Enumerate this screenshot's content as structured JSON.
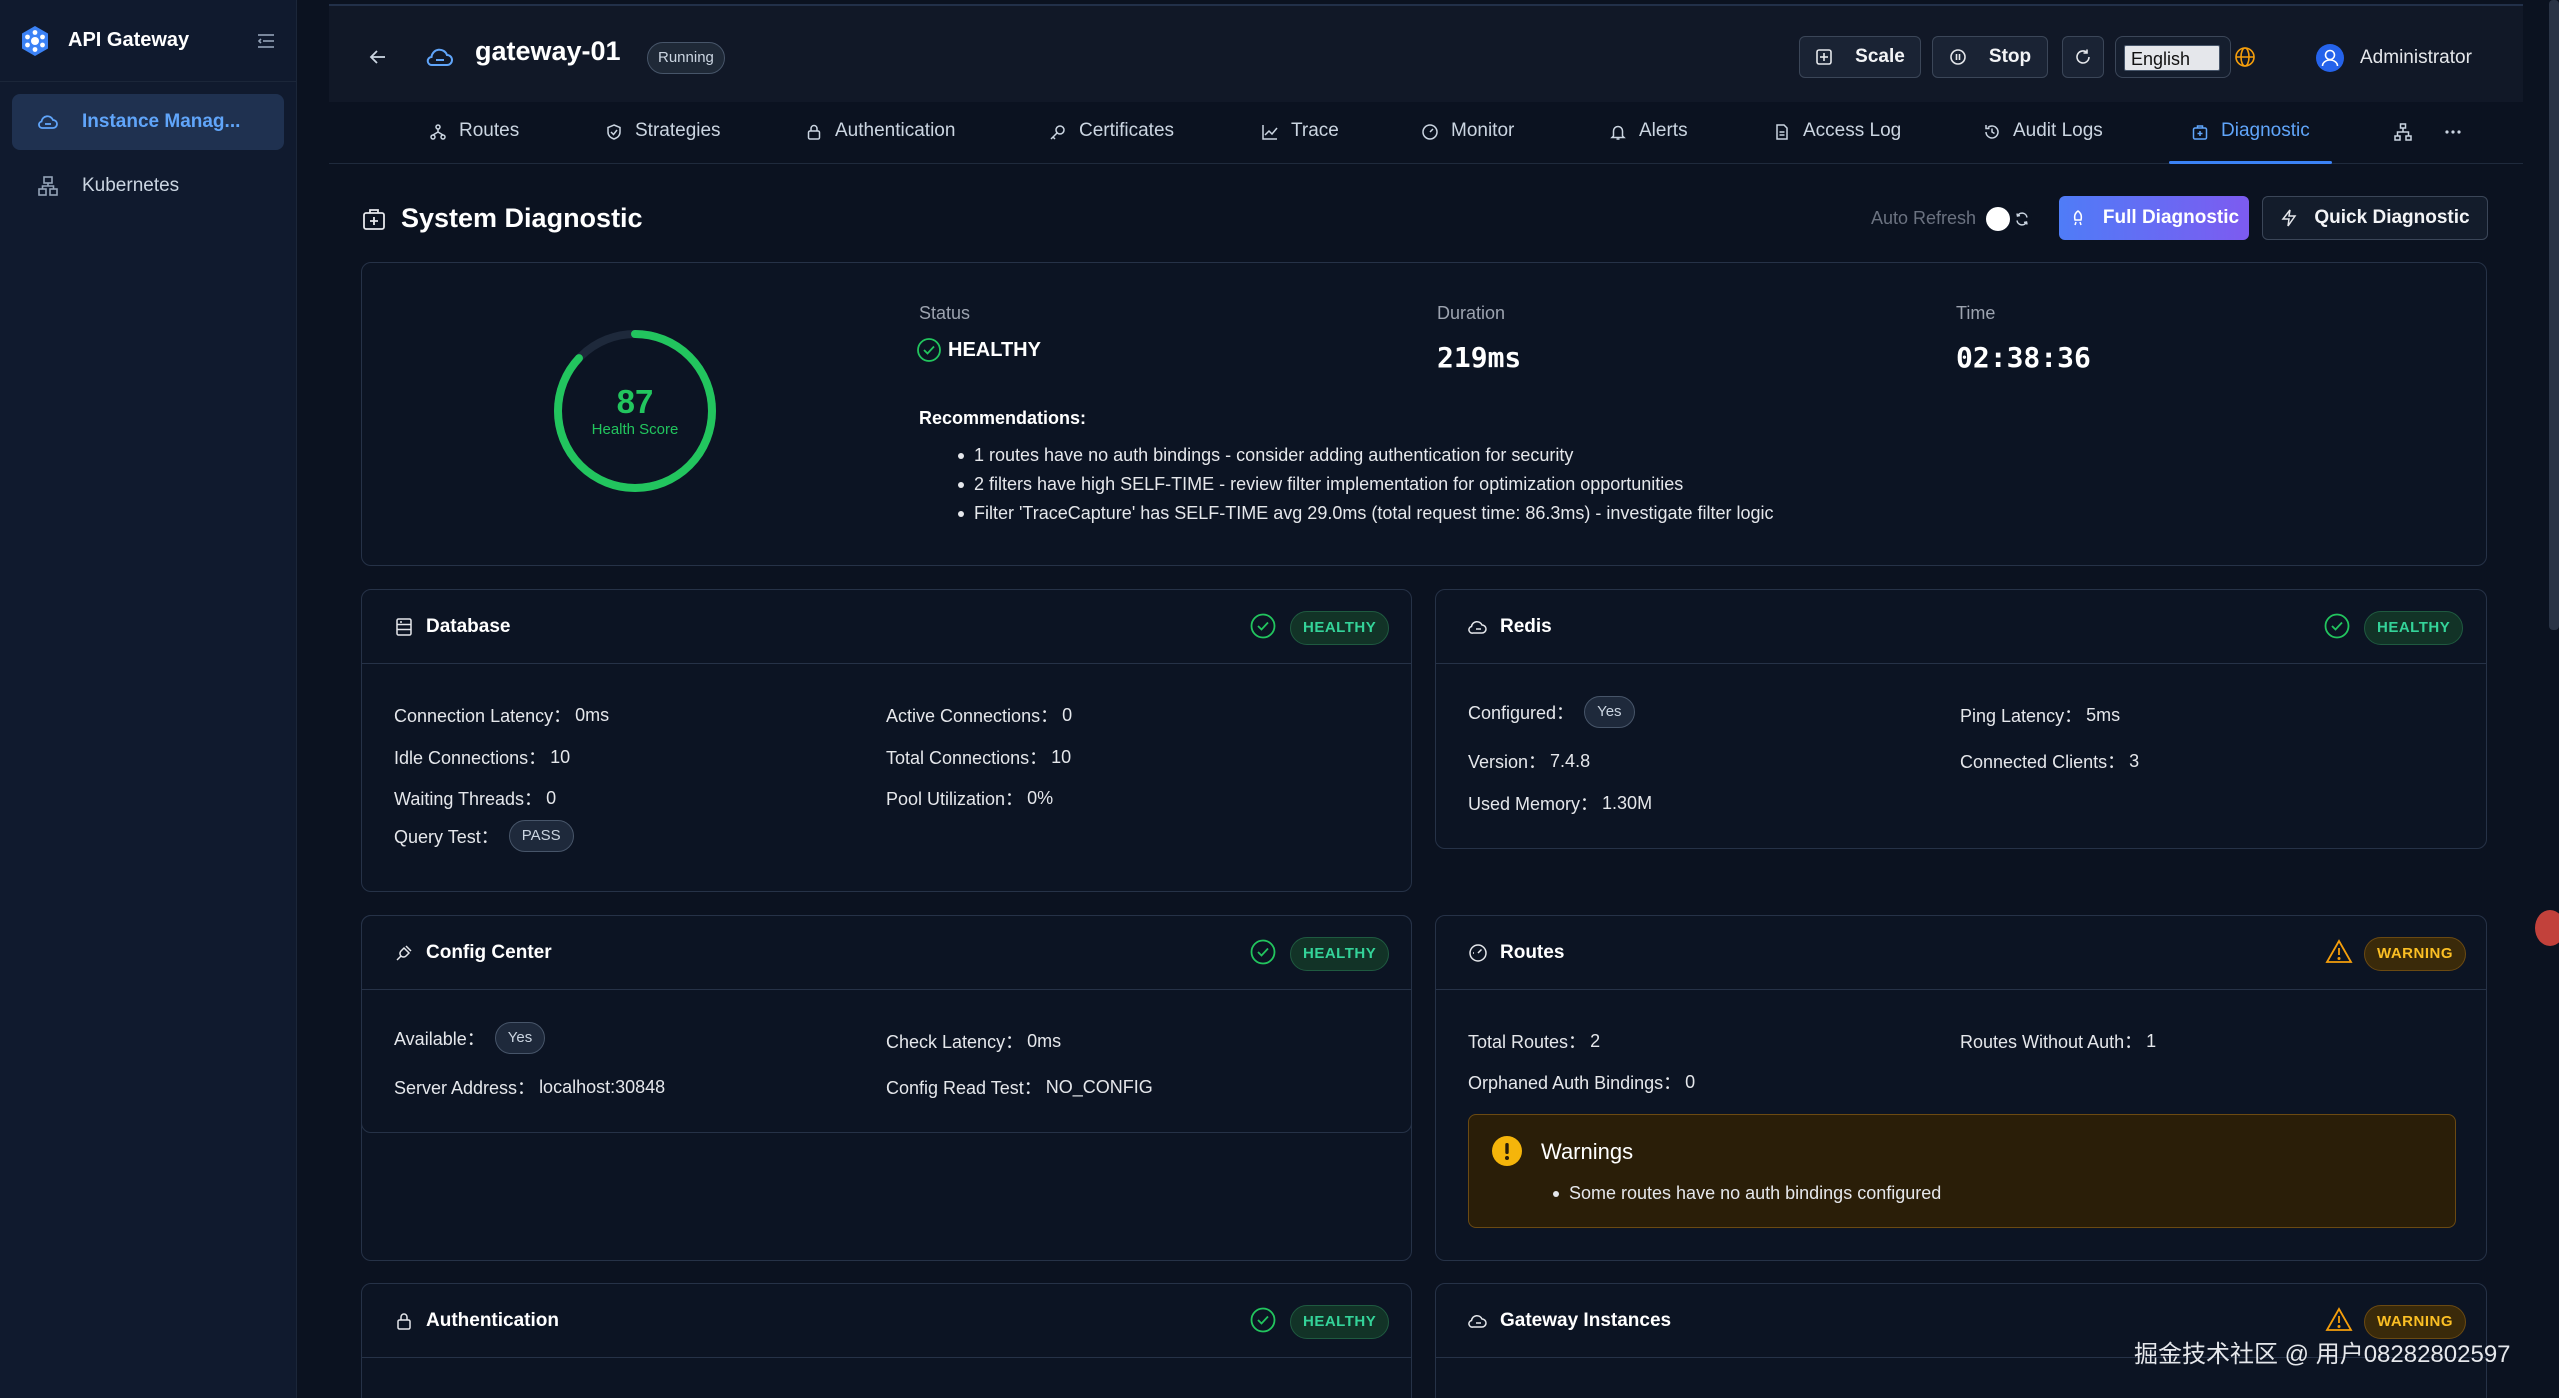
{
  "sidebar": {
    "app_title": "API Gateway",
    "items": [
      {
        "label": "Instance Manag...",
        "icon": "cloud-icon"
      },
      {
        "label": "Kubernetes",
        "icon": "cluster-icon"
      }
    ]
  },
  "header": {
    "gateway_name": "gateway-01",
    "status_badge": "Running",
    "scale_label": "Scale",
    "stop_label": "Stop",
    "language": "English",
    "user_name": "Administrator"
  },
  "tabs": [
    {
      "label": "Routes"
    },
    {
      "label": "Strategies"
    },
    {
      "label": "Authentication"
    },
    {
      "label": "Certificates"
    },
    {
      "label": "Trace"
    },
    {
      "label": "Monitor"
    },
    {
      "label": "Alerts"
    },
    {
      "label": "Access Log"
    },
    {
      "label": "Audit Logs"
    },
    {
      "label": "Diagnostic",
      "active": true
    }
  ],
  "diagnostic": {
    "title": "System Diagnostic",
    "auto_refresh_label": "Auto Refresh",
    "full_button": "Full Diagnostic",
    "quick_button": "Quick Diagnostic",
    "health_score": "87",
    "health_score_value": 87,
    "health_label": "Health Score",
    "status_label": "Status",
    "status_value": "HEALTHY",
    "duration_label": "Duration",
    "duration_value": "219ms",
    "time_label": "Time",
    "time_value": "02:38:36",
    "recommendations_title": "Recommendations:",
    "recommendations": [
      "1 routes have no auth bindings - consider adding authentication for security",
      "2 filters have high SELF-TIME - review filter implementation for optimization opportunities",
      "Filter 'TraceCapture' has SELF-TIME avg 29.0ms (total request time: 86.3ms) - investigate filter logic"
    ]
  },
  "database": {
    "title": "Database",
    "status": "HEALTHY",
    "fields": {
      "connection_latency": {
        "k": "Connection Latency：",
        "v": "0ms"
      },
      "active_connections": {
        "k": "Active Connections：",
        "v": "0"
      },
      "idle_connections": {
        "k": "Idle Connections：",
        "v": "10"
      },
      "total_connections": {
        "k": "Total Connections：",
        "v": "10"
      },
      "waiting_threads": {
        "k": "Waiting Threads：",
        "v": "0"
      },
      "pool_utilization": {
        "k": "Pool Utilization：",
        "v": "0%"
      },
      "query_test": {
        "k": "Query Test：",
        "v": "PASS"
      }
    }
  },
  "redis": {
    "title": "Redis",
    "status": "HEALTHY",
    "fields": {
      "configured": {
        "k": "Configured：",
        "v": "Yes"
      },
      "ping_latency": {
        "k": "Ping Latency：",
        "v": "5ms"
      },
      "version": {
        "k": "Version：",
        "v": "7.4.8"
      },
      "connected_clients": {
        "k": "Connected Clients：",
        "v": "3"
      },
      "used_memory": {
        "k": "Used Memory：",
        "v": "1.30M"
      }
    }
  },
  "config_center": {
    "title": "Config Center",
    "status": "HEALTHY",
    "fields": {
      "available": {
        "k": "Available：",
        "v": "Yes"
      },
      "check_latency": {
        "k": "Check Latency：",
        "v": "0ms"
      },
      "server_address": {
        "k": "Server Address：",
        "v": "localhost:30848"
      },
      "config_read_test": {
        "k": "Config Read Test：",
        "v": "NO_CONFIG"
      }
    }
  },
  "routes": {
    "title": "Routes",
    "status": "WARNING",
    "fields": {
      "total_routes": {
        "k": "Total Routes：",
        "v": "2"
      },
      "routes_without_auth": {
        "k": "Routes Without Auth：",
        "v": "1"
      },
      "orphaned_auth_bindings": {
        "k": "Orphaned Auth Bindings：",
        "v": "0"
      }
    },
    "warnings_title": "Warnings",
    "warnings": [
      "Some routes have no auth bindings configured"
    ]
  },
  "authentication": {
    "title": "Authentication",
    "status": "HEALTHY"
  },
  "gateway_instances": {
    "title": "Gateway Instances",
    "status": "WARNING"
  },
  "watermark": "掘金技术社区 @ 用户08282802597",
  "colors": {
    "accent": "#3b82f6",
    "healthy": "#22c55e",
    "warning": "#f59e0b",
    "background": "#0b1220"
  }
}
